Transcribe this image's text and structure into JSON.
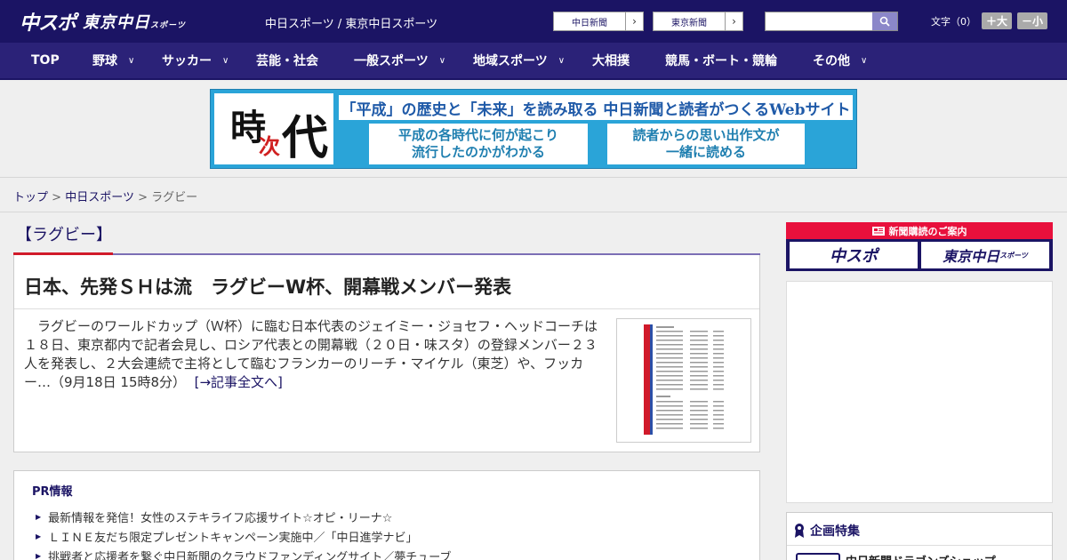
{
  "header": {
    "logo_main": "中スポ",
    "logo_sub": "東京中日",
    "logo_sub_small": "スポーツ",
    "site_title": "中日スポーツ / 東京中日スポーツ",
    "buttons": [
      {
        "label": "中日新聞"
      },
      {
        "label": "東京新聞"
      }
    ],
    "search_placeholder": "",
    "font_label": "文字（0）",
    "font_up": "＋大",
    "font_down": "－小"
  },
  "nav": [
    {
      "label": "TOP",
      "dropdown": false
    },
    {
      "label": "野球",
      "dropdown": true
    },
    {
      "label": "サッカー",
      "dropdown": true
    },
    {
      "label": "芸能・社会",
      "dropdown": false
    },
    {
      "label": "一般スポーツ",
      "dropdown": true
    },
    {
      "label": "地域スポーツ",
      "dropdown": true
    },
    {
      "label": "大相撲",
      "dropdown": false
    },
    {
      "label": "競馬・ボート・競輪",
      "dropdown": false
    },
    {
      "label": "その他",
      "dropdown": true
    }
  ],
  "banner": {
    "kanji1": "時",
    "kanji2": "次",
    "kanji3": "代",
    "headline": "「平成」の歴史と「未来」を読み取る 中日新聞と読者がつくるWebサイト",
    "box1_line1": "平成の各時代に何が起こり",
    "box1_line2": "流行したのかがわかる",
    "box2_line1": "読者からの思い出作文が",
    "box2_line2": "一緒に読める"
  },
  "breadcrumb": {
    "home": "トップ",
    "sep": ">",
    "parent": "中日スポーツ",
    "current": "ラグビー"
  },
  "section": {
    "title": "【ラグビー】"
  },
  "article": {
    "title": "日本、先発ＳＨは流　ラグビーW杯、開幕戦メンバー発表",
    "summary": "　ラグビーのワールドカップ（Ｗ杯）に臨む日本代表のジェイミー・ジョセフ・ヘッドコーチは１８日、東京都内で記者会見し、ロシア代表との開幕戦（２０日・味スタ）の登録メンバー２３人を発表し、２大会連続で主将として臨むフランカーのリーチ・マイケル（東芝）や、フッカー…",
    "timestamp": "（9月18日 15時8分）",
    "read_more": "[→記事全文へ]"
  },
  "pr": {
    "title": "PR情報",
    "items": [
      "最新情報を発信！女性のステキライフ応援サイト☆オピ・リーナ☆",
      "ＬＩＮＥ友だち限定プレゼントキャンペーン実施中／「中日進学ナビ」",
      "挑戦者と応援者を繋ぐ中日新聞のクラウドファンディングサイト／夢チューブ"
    ]
  },
  "sidebar": {
    "subscribe_title": "新聞購読のご案内",
    "subscribe_a": "中スポ",
    "subscribe_b": "東京中日",
    "subscribe_b_small": "スポーツ",
    "feature_title": "企画特集",
    "feature_item": "中日新聞ドラゴンズショップ"
  },
  "colors": {
    "brand_navy": "#1b1464",
    "nav_bg": "#2b2278",
    "accent_red": "#d11a2a",
    "accent_purple": "#7c6fb5"
  }
}
